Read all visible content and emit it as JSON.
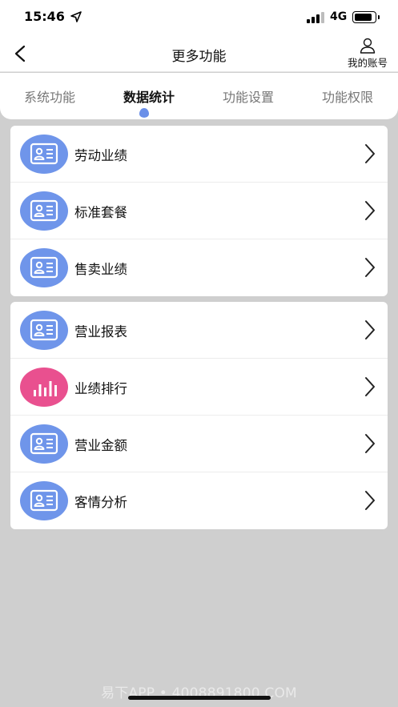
{
  "status_bar": {
    "time": "15:46",
    "network": "4G"
  },
  "header": {
    "title": "更多功能",
    "account_label": "我的账号"
  },
  "tabs": [
    {
      "label": "系统功能",
      "active": false
    },
    {
      "label": "数据统计",
      "active": true
    },
    {
      "label": "功能设置",
      "active": false
    },
    {
      "label": "功能权限",
      "active": false
    }
  ],
  "group1": [
    {
      "label": "劳动业绩",
      "icon": "id-card-icon"
    },
    {
      "label": "标准套餐",
      "icon": "id-card-icon"
    },
    {
      "label": "售卖业绩",
      "icon": "id-card-icon"
    }
  ],
  "group2": [
    {
      "label": "营业报表",
      "icon": "id-card-icon"
    },
    {
      "label": "业绩排行",
      "icon": "bar-chart-icon"
    },
    {
      "label": "营业金额",
      "icon": "id-card-icon"
    },
    {
      "label": "客情分析",
      "icon": "id-card-icon"
    }
  ],
  "watermark": "易下APP • 4008891800.COM",
  "colors": {
    "icon_blue": "#6f95ea",
    "icon_pink": "#e9508f",
    "background": "#cfcfcf"
  }
}
